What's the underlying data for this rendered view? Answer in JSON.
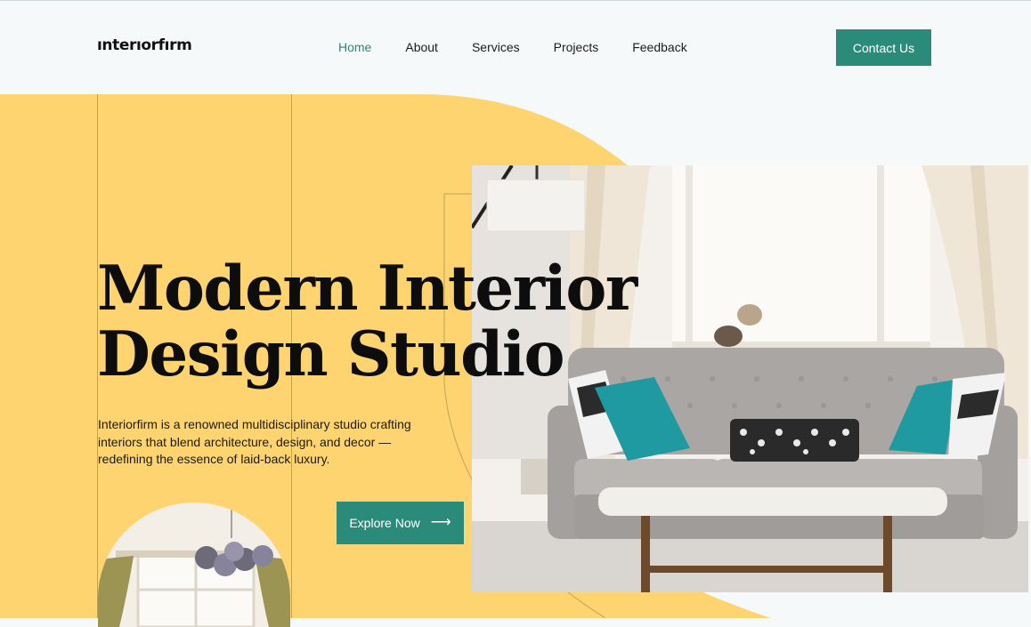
{
  "brand": {
    "logo_text": "ınterıorfırm"
  },
  "nav": {
    "items": [
      {
        "label": "Home",
        "active": true
      },
      {
        "label": "About",
        "active": false
      },
      {
        "label": "Services",
        "active": false
      },
      {
        "label": "Projects",
        "active": false
      },
      {
        "label": "Feedback",
        "active": false
      }
    ],
    "contact_label": "Contact Us"
  },
  "hero": {
    "title_line1": "Modern Interior",
    "title_line2": "Design Studio",
    "description": "Interiorfirm is a renowned multidisciplinary studio crafting interiors that blend architecture, design, and decor — redefining the essence of laid-back luxury.",
    "cta_label": "Explore Now",
    "cta_icon": "arrow-right-icon",
    "cta_glyph": "⟶"
  },
  "colors": {
    "accent": "#2a8b7a",
    "nav_active": "#2d8577",
    "hero_yellow": "#fdd470",
    "background": "#f6f9f9"
  }
}
